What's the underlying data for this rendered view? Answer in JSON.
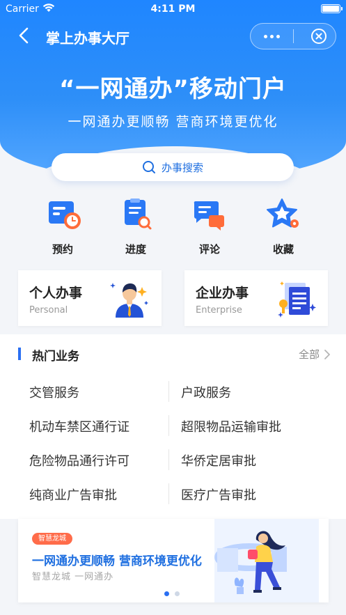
{
  "status": {
    "carrier": "Carrier",
    "time": "4:11 PM"
  },
  "nav": {
    "title": "掌上办事大厅"
  },
  "hero": {
    "title": "“一网通办”移动门户",
    "subtitle": "一网通办更顺畅  营商环境更优化"
  },
  "search": {
    "label": "办事搜索"
  },
  "quick_actions": [
    {
      "label": "预约",
      "icon": "calendar-clock-icon"
    },
    {
      "label": "进度",
      "icon": "clipboard-search-icon"
    },
    {
      "label": "评论",
      "icon": "chat-bubbles-icon"
    },
    {
      "label": "收藏",
      "icon": "star-icon"
    }
  ],
  "cards": [
    {
      "title": "个人办事",
      "subtitle": "Personal",
      "icon": "person-icon"
    },
    {
      "title": "企业办事",
      "subtitle": "Enterprise",
      "icon": "documents-icon"
    }
  ],
  "hot": {
    "title": "热门业务",
    "all_label": "全部",
    "items": [
      "交管服务",
      "户政服务",
      "机动车禁区通行证",
      "超限物品运输审批",
      "危险物品通行许可",
      "华侨定居审批",
      "纯商业广告审批",
      "医疗广告审批"
    ]
  },
  "banner": {
    "tag": "智慧龙城",
    "title": "一网通办更顺畅  营商环境更优化",
    "subtitle": "智慧龙城  一网通办",
    "page_index": 1,
    "page_count": 2
  },
  "colors": {
    "primary": "#2a6ff2",
    "hero": "#1f86ff",
    "tag": "#ff6c4a"
  }
}
